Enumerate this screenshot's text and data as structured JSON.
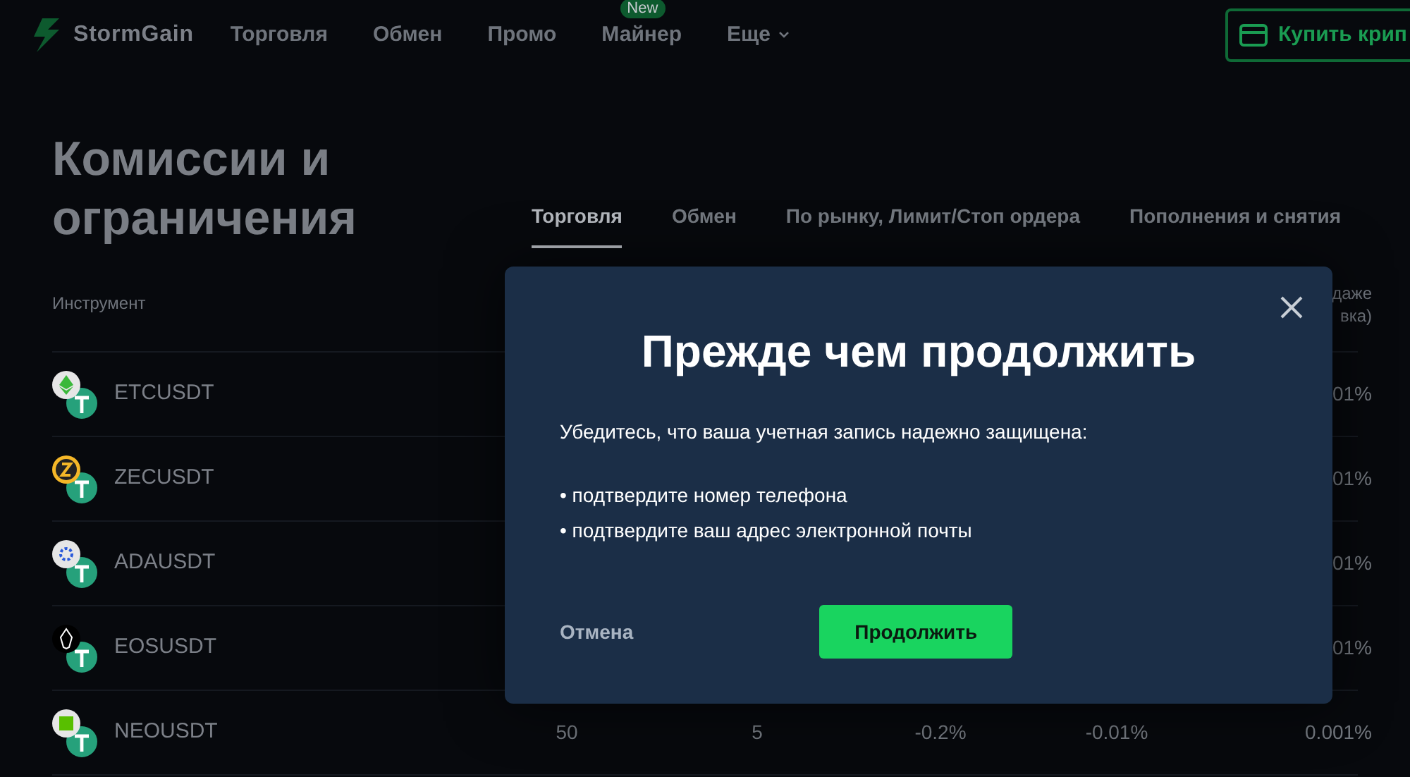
{
  "nav": {
    "logo": "StormGain",
    "items": [
      {
        "label": "Торговля",
        "dropdown": false
      },
      {
        "label": "Обмен",
        "dropdown": false
      },
      {
        "label": "Промо",
        "dropdown": false
      },
      {
        "label": "Майнер",
        "badge": "New",
        "dropdown": false
      },
      {
        "label": "Еще",
        "dropdown": true
      }
    ],
    "buy_button": "Купить крип"
  },
  "page_title": "Комиссии и ограничения",
  "tabs": [
    {
      "label": "Торговля",
      "selected": true
    },
    {
      "label": "Обмен",
      "selected": false
    },
    {
      "label": "По рынку, Лимит/Стоп ордера",
      "selected": false
    },
    {
      "label": "Пополнения и снятия",
      "selected": false
    }
  ],
  "table": {
    "column_1": "Инструмент",
    "column_6": [
      "даже",
      "вка)"
    ],
    "rows": [
      {
        "pair": "ETCUSDT",
        "kind": "etc",
        "cells": [
          "01%"
        ]
      },
      {
        "pair": "ZECUSDT",
        "kind": "zec",
        "cells": [
          "01%"
        ]
      },
      {
        "pair": "ADAUSDT",
        "kind": "ada",
        "cells": [
          "01%"
        ]
      },
      {
        "pair": "EOSUSDT",
        "kind": "eos",
        "cells": [
          "01%"
        ]
      },
      {
        "pair": "NEOUSDT",
        "kind": "neo",
        "cells": [
          "50",
          "5",
          "-0.2%",
          "-0.01%",
          "0.001%"
        ]
      }
    ]
  },
  "dialog": {
    "title": "Прежде чем продолжить",
    "message": "Убедитесь, что ваша учетная запись надежно защищена:",
    "bullets": [
      "• подтвердите номер телефона",
      "• подтвердите ваш адрес электронной почты"
    ],
    "cancel": "Отмена",
    "confirm": "Продолжить"
  }
}
